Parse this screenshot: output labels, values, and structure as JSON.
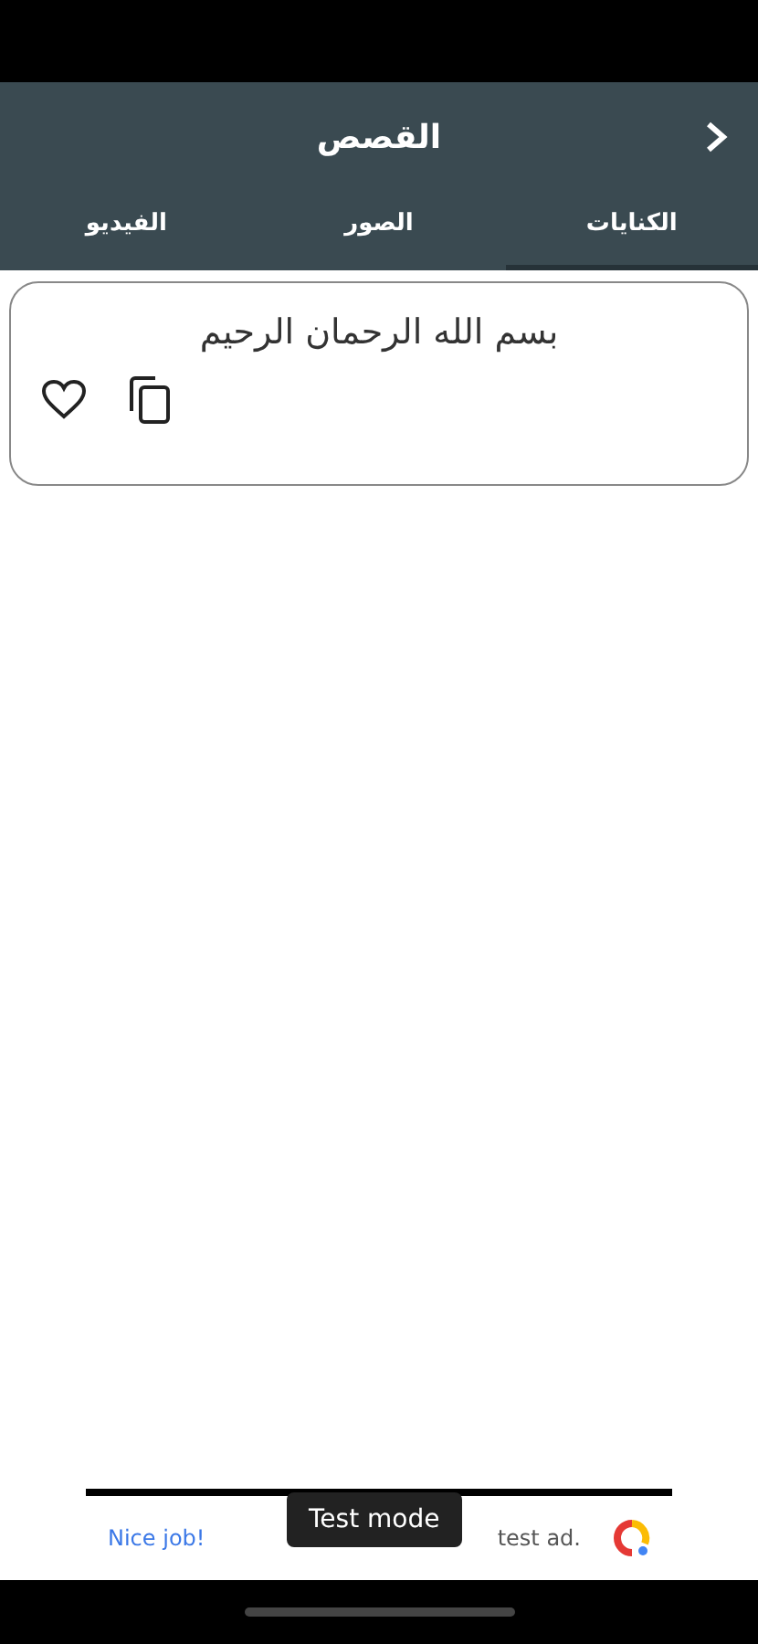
{
  "app_bar": {
    "title": "القصص"
  },
  "tabs": [
    {
      "label": "الكنايات",
      "selected": true
    },
    {
      "label": "الصور",
      "selected": false
    },
    {
      "label": "الفيديو",
      "selected": false
    }
  ],
  "cards": [
    {
      "text": "بسم الله الرحمان الرحيم",
      "favorite": false
    }
  ],
  "ad_banner": {
    "left_text": "Nice job!",
    "right_text": "test ad.",
    "badge": "Test mode"
  }
}
